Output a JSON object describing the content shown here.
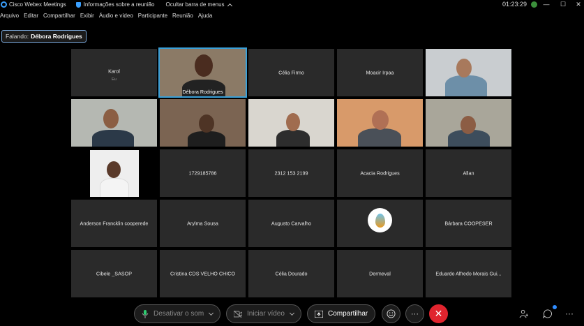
{
  "titlebar": {
    "app_title": "Cisco Webex Meetings",
    "meeting_info": "Informações sobre a reunião",
    "hide_menu": "Ocultar barra de menus",
    "clock": "01:23:29",
    "minimize": "—",
    "maximize": "☐",
    "close": "✕"
  },
  "menu": {
    "items": [
      "Arquivo",
      "Editar",
      "Compartilhar",
      "Exibir",
      "Áudio e vídeo",
      "Participante",
      "Reunião",
      "Ajuda"
    ]
  },
  "speaking": {
    "label": "Falando:",
    "name": "Débora Rodrigues"
  },
  "tiles": [
    {
      "name": "Karol",
      "sub": "Eu"
    },
    {
      "name": "Débora Rodrigues",
      "video": true
    },
    {
      "name": "Célia Firmo"
    },
    {
      "name": "Moacir Irpaa"
    },
    {
      "name": "",
      "video": true
    },
    {
      "name": "",
      "video": true
    },
    {
      "name": "",
      "video": true
    },
    {
      "name": "",
      "video": true
    },
    {
      "name": "",
      "video": true
    },
    {
      "name": "",
      "video": true
    },
    {
      "name": "",
      "video": true
    },
    {
      "name": "1729185786"
    },
    {
      "name": "2312 153 2199"
    },
    {
      "name": "Acacia Rodrigues"
    },
    {
      "name": "Allan"
    },
    {
      "name": "Anderson Francklin cooperede"
    },
    {
      "name": "Arylma Sousa"
    },
    {
      "name": "Augusto Carvalho"
    },
    {
      "name": "",
      "logo": true
    },
    {
      "name": "Bárbara COOPESER"
    },
    {
      "name": "Cibele _SASOP"
    },
    {
      "name": "Cristina CDS VELHO CHICO"
    },
    {
      "name": "Célia Dourado"
    },
    {
      "name": "Dermeval"
    },
    {
      "name": "Eduardo Alfredo Morais Gui..."
    }
  ],
  "controls": {
    "mute": "Desativar o som",
    "video": "Iniciar vídeo",
    "share": "Compartilhar",
    "reactions_icon": "smiley-icon",
    "more": "···",
    "end": "✕"
  },
  "colors": {
    "active_outline": "#3aa0d8",
    "end_button": "#e0242e",
    "tile_bg": "#2a2a2a"
  }
}
